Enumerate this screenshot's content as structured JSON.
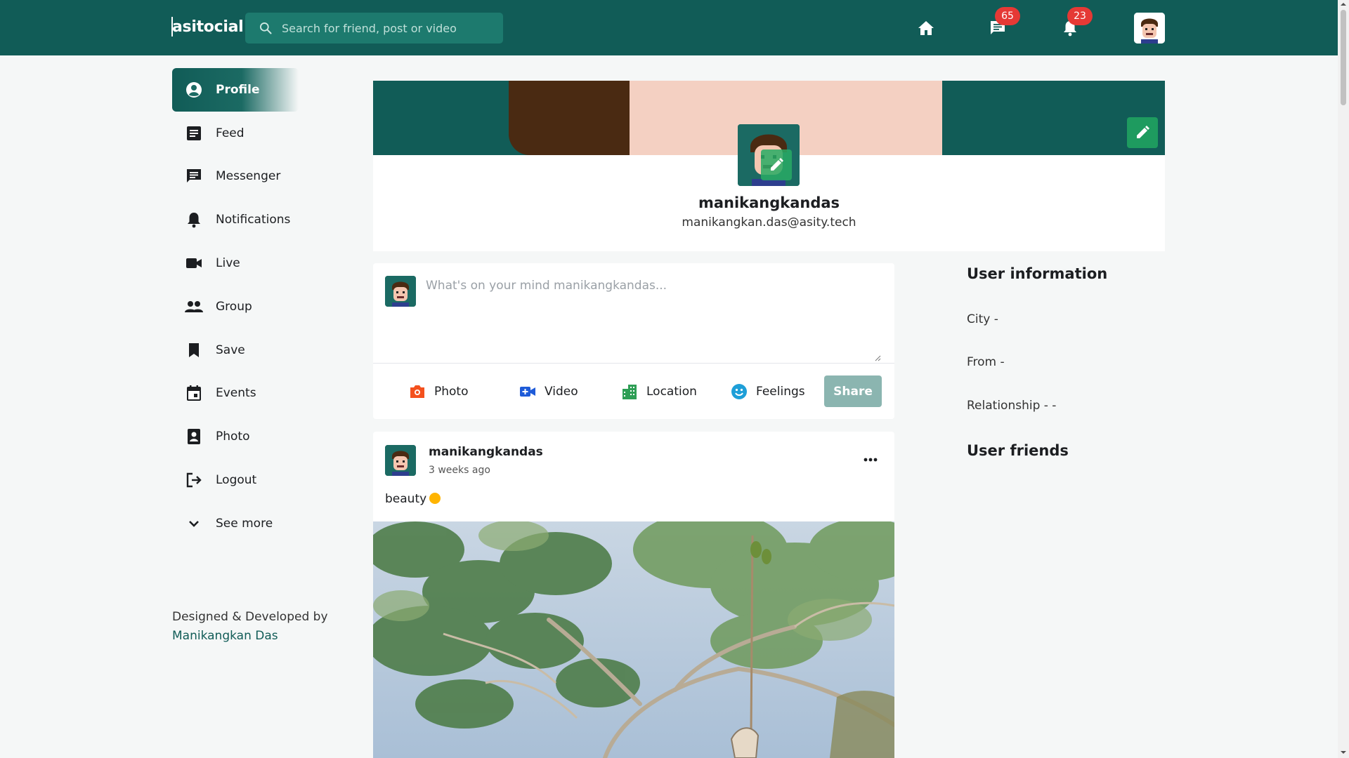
{
  "header": {
    "brand": "asitocial",
    "search_placeholder": "Search for friend, post or video",
    "messages_badge": "65",
    "notifications_badge": "23"
  },
  "sidebar": {
    "items": [
      {
        "label": "Profile",
        "icon": "account-circle-icon",
        "active": true
      },
      {
        "label": "Feed",
        "icon": "article-icon"
      },
      {
        "label": "Messenger",
        "icon": "chat-icon"
      },
      {
        "label": "Notifications",
        "icon": "bell-icon"
      },
      {
        "label": "Live",
        "icon": "videocam-icon"
      },
      {
        "label": "Group",
        "icon": "people-icon"
      },
      {
        "label": "Save",
        "icon": "bookmark-icon"
      },
      {
        "label": "Events",
        "icon": "calendar-icon"
      },
      {
        "label": "Photo",
        "icon": "portrait-icon"
      },
      {
        "label": "Logout",
        "icon": "logout-icon"
      },
      {
        "label": "See more",
        "icon": "chevron-down-icon"
      }
    ],
    "credit_line": "Designed & Developed by",
    "credit_name": "Manikangkan Das"
  },
  "profile": {
    "name": "manikangkandas",
    "email": "manikangkan.das@asity.tech"
  },
  "composer": {
    "placeholder": "What's on your mind manikangkandas...",
    "actions": [
      {
        "label": "Photo",
        "icon": "camera-icon",
        "color": "#f4511e"
      },
      {
        "label": "Video",
        "icon": "video-add-icon",
        "color": "#1e5bd8"
      },
      {
        "label": "Location",
        "icon": "location-city-icon",
        "color": "#2e9e55"
      },
      {
        "label": "Feelings",
        "icon": "smile-icon",
        "color": "#1e9fd8"
      }
    ],
    "share_label": "Share"
  },
  "post": {
    "author": "manikangkandas",
    "time": "3 weeks ago",
    "text": "beauty"
  },
  "user_info": {
    "title": "User information",
    "city": "City -",
    "from": "From -",
    "relationship": "Relationship - -",
    "friends_title": "User friends"
  },
  "colors": {
    "primary": "#115c57",
    "badge": "#e53935",
    "edit_green": "#1e9b5f"
  }
}
